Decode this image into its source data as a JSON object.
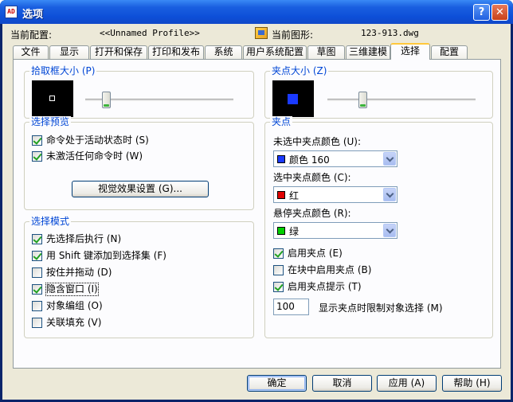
{
  "window": {
    "title": "选项",
    "icon_text": "AD",
    "help_glyph": "?",
    "close_glyph": "✕"
  },
  "header": {
    "profile_label": "当前配置:",
    "profile_value": "<<Unnamed Profile>>",
    "drawing_label": "当前图形:",
    "drawing_value": "123-913.dwg"
  },
  "tabs": [
    "文件",
    "显示",
    "打开和保存",
    "打印和发布",
    "系统",
    "用户系统配置",
    "草图",
    "三维建模",
    "选择",
    "配置"
  ],
  "active_tab_index": 8,
  "pickbox": {
    "title": "拾取框大小 (P)",
    "slider_value": 0.12
  },
  "gripsize": {
    "title": "夹点大小 (Z)",
    "slider_value": 0.22
  },
  "selection_preview": {
    "title": "选择预览",
    "items": [
      {
        "label": "命令处于活动状态时 (S)",
        "checked": true
      },
      {
        "label": "未激活任何命令时 (W)",
        "checked": true
      }
    ],
    "visual_button": "视觉效果设置 (G)..."
  },
  "selection_modes": {
    "title": "选择模式",
    "items": [
      {
        "label": "先选择后执行 (N)",
        "checked": true
      },
      {
        "label": "用 Shift 键添加到选择集 (F)",
        "checked": true
      },
      {
        "label": "按住并拖动 (D)",
        "checked": false
      },
      {
        "label": "隐含窗口 (I)",
        "checked": true
      },
      {
        "label": "对象编组 (O)",
        "checked": false
      },
      {
        "label": "关联填充 (V)",
        "checked": false
      }
    ]
  },
  "grips": {
    "title": "夹点",
    "unselected_label": "未选中夹点颜色 (U):",
    "unselected_value": "颜色 160",
    "unselected_color": "#1a3aff",
    "selected_label": "选中夹点颜色 (C):",
    "selected_value": "红",
    "selected_color": "#e00000",
    "hover_label": "悬停夹点颜色 (R):",
    "hover_value": "绿",
    "hover_color": "#00d000",
    "options": [
      {
        "label": "启用夹点 (E)",
        "checked": true
      },
      {
        "label": "在块中启用夹点 (B)",
        "checked": false
      },
      {
        "label": "启用夹点提示 (T)",
        "checked": true
      }
    ],
    "limit_value": "100",
    "limit_label": "显示夹点时限制对象选择 (M)"
  },
  "footer": {
    "ok": "确定",
    "cancel": "取消",
    "apply": "应用 (A)",
    "help": "帮助 (H)"
  }
}
